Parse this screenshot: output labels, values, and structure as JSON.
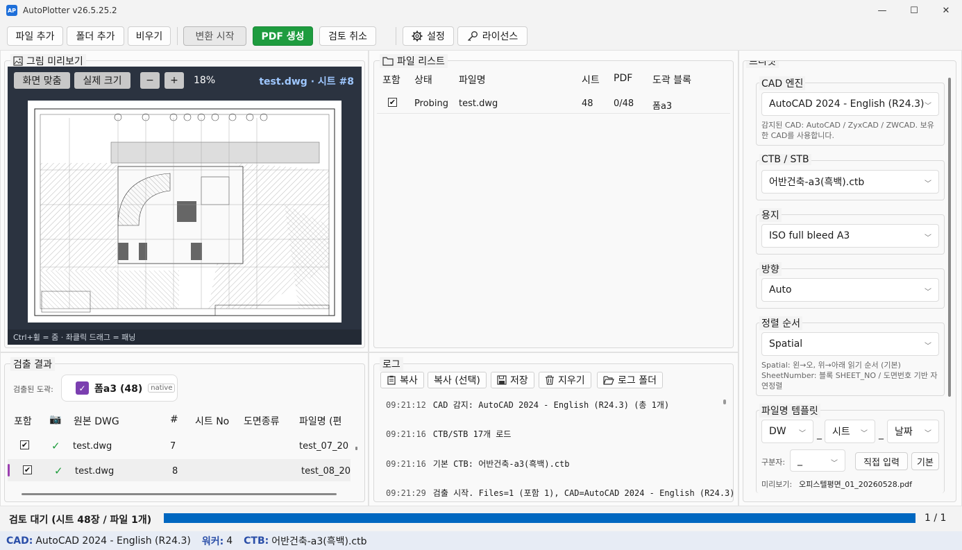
{
  "app": {
    "icon": "AP",
    "title": "AutoPlotter v26.5.25.2"
  },
  "window_controls": {
    "minimize": "—",
    "maximize": "☐",
    "close": "✕"
  },
  "toolbar": {
    "add_file": "파일 추가",
    "add_folder": "폴더 추가",
    "clear": "비우기",
    "convert_start": "변환 시작",
    "pdf_generate": "PDF 생성",
    "cancel_review": "검토 취소",
    "settings": "설정",
    "license": "라이선스"
  },
  "preview": {
    "title": "그림 미리보기",
    "fit": "화면 맞춤",
    "actual": "실제 크기",
    "zoom_out": "−",
    "zoom_in": "+",
    "zoom": "18%",
    "file": "test.dwg · 시트 #8",
    "footer": "Ctrl+휠 = 줌 · 좌클릭 드래그 = 패닝"
  },
  "file_list": {
    "title": "파일 리스트",
    "headers": [
      "포함",
      "상태",
      "파일명",
      "시트",
      "PDF",
      "도곽 블록"
    ],
    "rows": [
      {
        "include": "✔",
        "status": "Probing",
        "name": "test.dwg",
        "sheets": "48",
        "pdf": "0/48",
        "block": "폼a3"
      }
    ]
  },
  "detect": {
    "title": "검출 결과",
    "found_label": "검출된 도곽:",
    "chip_label": "폼a3 (48)",
    "chip_tag": "native",
    "headers": [
      "포함",
      "📷",
      "원본 DWG",
      "#",
      "시트 No",
      "도면종류",
      "파일명 (편"
    ],
    "rows": [
      {
        "include": "✔",
        "ok": "✓",
        "dwg": "test.dwg",
        "num": "7",
        "sheet_no": "",
        "kind": "",
        "fname": "test_07_20"
      },
      {
        "include": "✔",
        "ok": "✓",
        "dwg": "test.dwg",
        "num": "8",
        "sheet_no": "",
        "kind": "",
        "fname": "test_08_20"
      }
    ]
  },
  "log": {
    "title": "로그",
    "copy": "복사",
    "copy_sel": "복사 (선택)",
    "save": "저장",
    "clear": "지우기",
    "folder": "로그 폴더",
    "lines": [
      {
        "ts": "09:21:12",
        "msg": "CAD 감지: AutoCAD 2024 - English (R24.3) (총 1개)"
      },
      {
        "ts": "09:21:16",
        "msg": "CTB/STB 17개 로드"
      },
      {
        "ts": "09:21:16",
        "msg": "기본 CTB: 어반건축-a3(흑백).ctb"
      },
      {
        "ts": "09:21:29",
        "msg": "검출 시작. Files=1 (포함 1), CAD=AutoCAD 2024 - English (R24.3)"
      }
    ]
  },
  "presets": {
    "title": "프리셋",
    "cad_engine_label": "CAD 엔진",
    "cad_engine_value": "AutoCAD 2024 - English (R24.3)",
    "cad_engine_hint": "감지된 CAD: AutoCAD / ZyxCAD / ZWCAD. 보유한 CAD를 사용합니다.",
    "ctb_label": "CTB / STB",
    "ctb_value": "어반건축-a3(흑백).ctb",
    "paper_label": "용지",
    "paper_value": "ISO full bleed A3",
    "orient_label": "방향",
    "orient_value": "Auto",
    "sort_label": "정렬 순서",
    "sort_value": "Spatial",
    "sort_hint": "Spatial: 왼→오, 위→아래 읽기 순서 (기본) SheetNumber: 블록 SHEET_NO / 도면번호 기반 자연정렬",
    "template_label": "파일명 템플릿",
    "tpl_1": "DW",
    "tpl_2": "시트",
    "tpl_3": "날짜",
    "sep": "_",
    "delim_label": "구분자:",
    "delim_value": "_",
    "manual": "직접 입력",
    "default": "기본",
    "preview_label": "미리보기:",
    "preview_value": "오피스텔평면_01_20260528.pdf"
  },
  "progress": {
    "text": "검토 대기 (시트 48장 / 파일 1개)",
    "fraction": 1.0,
    "count": "1 / 1"
  },
  "status": {
    "cad_k": "CAD:",
    "cad_v": "AutoCAD 2024 - English (R24.3)",
    "worker_k": "워커:",
    "worker_v": "4",
    "ctb_k": "CTB:",
    "ctb_v": "어반건축-a3(흑백).ctb"
  },
  "colors": {
    "accent": "#0067c0",
    "primary_green": "#1e9c3f",
    "check_green": "#1a9b3a",
    "chip_purple": "#7b3fb0"
  }
}
